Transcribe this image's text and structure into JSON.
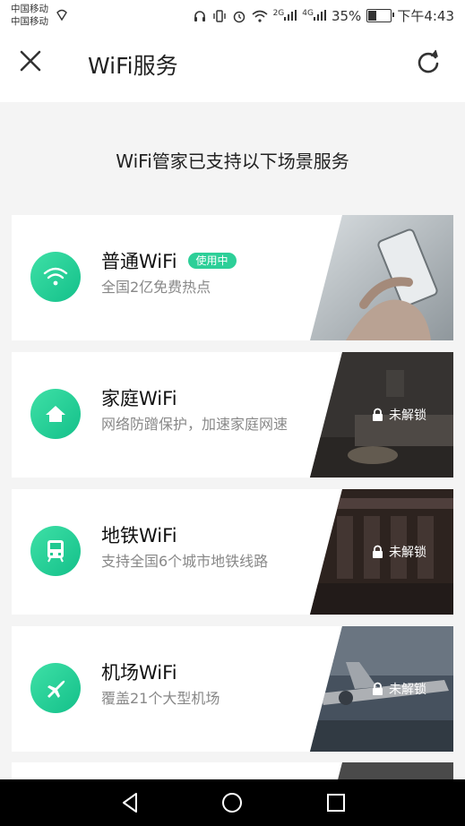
{
  "status_bar": {
    "carrier1": "中国移动",
    "carrier2": "中国移动",
    "signal_2g": "2G",
    "signal_4g": "4G",
    "battery_text": "35%",
    "battery_level": 0.35,
    "time": "下午4:43"
  },
  "app_bar": {
    "title": "WiFi服务",
    "close_icon": "close-icon",
    "refresh_icon": "refresh-icon"
  },
  "subtitle": "WiFi管家已支持以下场景服务",
  "services": [
    {
      "name": "普通WiFi",
      "badge": "使用中",
      "desc": "全国2亿免费热点",
      "icon": "wifi-icon",
      "locked": false
    },
    {
      "name": "家庭WiFi",
      "desc": "网络防蹭保护，加速家庭网速",
      "icon": "home-icon",
      "locked": true,
      "lock_text": "未解锁"
    },
    {
      "name": "地铁WiFi",
      "desc": "支持全国6个城市地铁线路",
      "icon": "subway-icon",
      "locked": true,
      "lock_text": "未解锁"
    },
    {
      "name": "机场WiFi",
      "desc": "覆盖21个大型机场",
      "icon": "plane-icon",
      "locked": true,
      "lock_text": "未解锁"
    }
  ],
  "colors": {
    "accent": "#2dcf98",
    "background": "#f4f4f4"
  }
}
